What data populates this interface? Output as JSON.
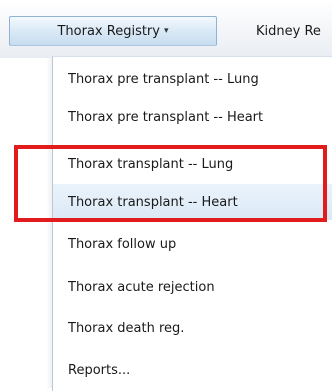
{
  "menubar": {
    "active_menu": "Thorax Registry",
    "active_caret": "▾",
    "next_menu": "Kidney Re"
  },
  "dropdown": {
    "items": [
      {
        "label": "Thorax pre transplant -- Lung"
      },
      {
        "label": "Thorax pre transplant -- Heart"
      },
      {
        "label": "Thorax transplant -- Lung"
      },
      {
        "label": "Thorax transplant -- Heart",
        "hovered": true
      },
      {
        "label": "Thorax follow up"
      },
      {
        "label": "Thorax acute rejection"
      },
      {
        "label": "Thorax death reg."
      },
      {
        "label": "Reports..."
      }
    ]
  },
  "annotation": {
    "color": "#e21c1c"
  }
}
